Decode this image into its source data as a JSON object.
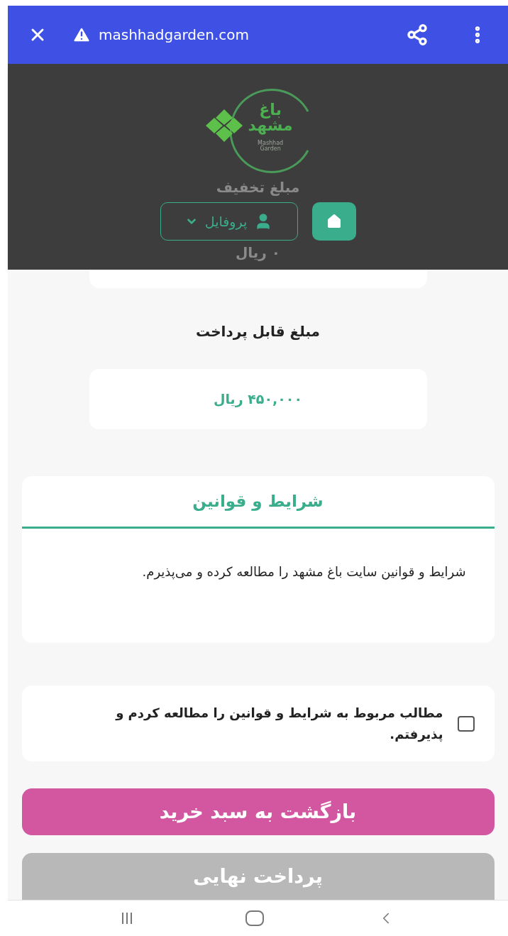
{
  "browser_bar": {
    "url": "mashhadgarden.com"
  },
  "header": {
    "logo": {
      "name_line_1": "باغ",
      "name_line_2": "مشهد",
      "subtitle_line_1": "Mashhad",
      "subtitle_line_2": "Garden"
    },
    "behind_texts": [
      "مبلغ تخفیف",
      "۰ ریال"
    ],
    "profile_button": "پروفایل"
  },
  "payable": {
    "label": "مبلغ قابل پرداخت",
    "amount": "۴۵۰,۰۰۰ ریال"
  },
  "terms": {
    "title": "شرایط و قوانین",
    "body": "شرایط و قوانین سایت باغ مشهد را مطالعه کرده و می‌پذیرم."
  },
  "agreement": {
    "label": "مطالب مربوط به شرایط و قوانین را مطالعه کردم و پذیرفتم.",
    "checked": false
  },
  "buttons": [
    {
      "label": "بازگشت به سبد خرید",
      "disabled": false
    },
    {
      "label": "پرداخت نهایی",
      "disabled": true
    }
  ]
}
